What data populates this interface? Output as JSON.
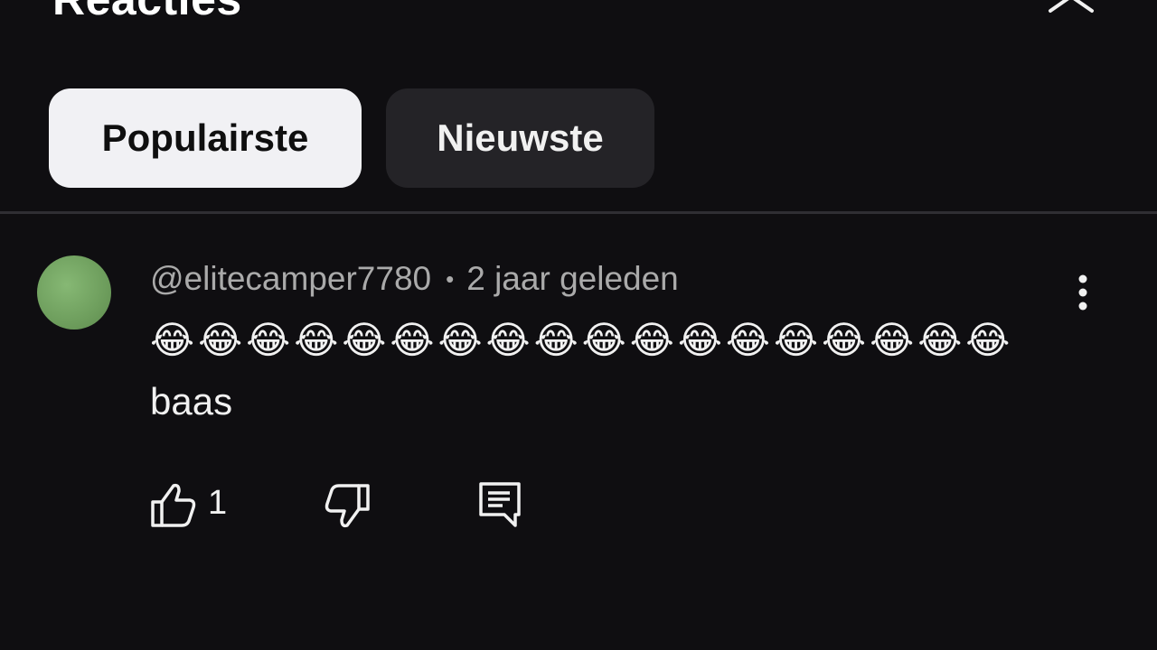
{
  "header": {
    "title": "Reacties",
    "close_icon": "close-icon"
  },
  "sort_chips": [
    {
      "label": "Populairste",
      "active": true
    },
    {
      "label": "Nieuwste",
      "active": false
    }
  ],
  "comment": {
    "author": "@elitecamper7780",
    "separator": "•",
    "time": "2 jaar geleden",
    "text_emoji": "😂😂😂😂😂😂😂😂😂😂😂😂😂😂😂😂😂😂",
    "text_word": "baas",
    "avatar_color": "#72a562",
    "like_count": "1",
    "icons": {
      "like": "thumbs-up-icon",
      "dislike": "thumbs-down-icon",
      "reply": "reply-comment-icon",
      "more": "more-vertical-icon"
    }
  },
  "colors": {
    "background": "#0f0e11",
    "chip_active_bg": "#f1f1f4",
    "chip_inactive_bg": "#242327",
    "meta_text": "#aaaaaa",
    "primary_text": "#f1f1f1"
  }
}
